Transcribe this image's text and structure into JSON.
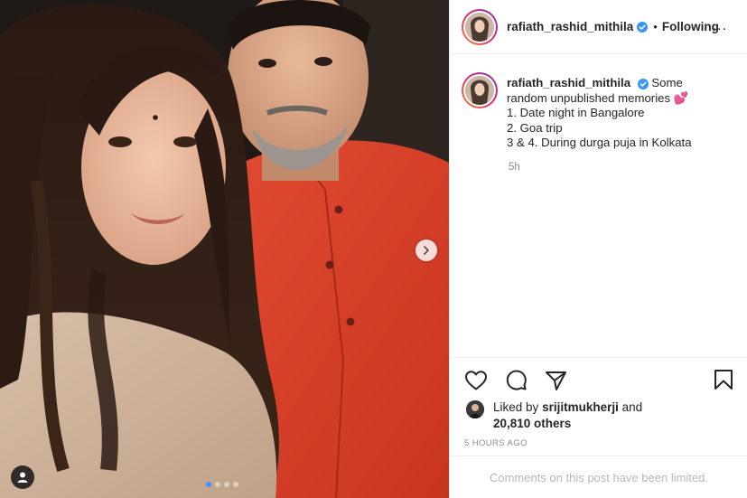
{
  "post": {
    "username": "rafiath_rashid_mithila",
    "separator": "•",
    "follow_status": "Following",
    "more_label": "...",
    "caption": {
      "username": "rafiath_rashid_mithila",
      "lines": [
        "Some",
        "random unpublished memories 💕",
        "1. Date night in Bangalore",
        "2. Goa trip",
        "3 & 4. During durga puja in Kolkata"
      ],
      "time": "5h"
    },
    "likes": {
      "prefix": "Liked by",
      "user": "srijitmukherji",
      "conjunction": "and",
      "others": "20,810 others"
    },
    "date": "5 HOURS AGO",
    "comments_notice": "Comments on this post have been limited."
  },
  "carousel": {
    "count": 4,
    "active_index": 0
  },
  "colors": {
    "verified": "#3897f0",
    "text": "#262626",
    "muted": "#8e8e8e",
    "shirt": "#d8402c",
    "story_ring": [
      "#f58529",
      "#dd2a7b",
      "#8134af"
    ]
  },
  "icons": [
    "verified-badge-icon",
    "heart-icon",
    "comment-icon",
    "share-icon",
    "bookmark-icon",
    "chevron-right-icon",
    "user-tag-icon"
  ]
}
